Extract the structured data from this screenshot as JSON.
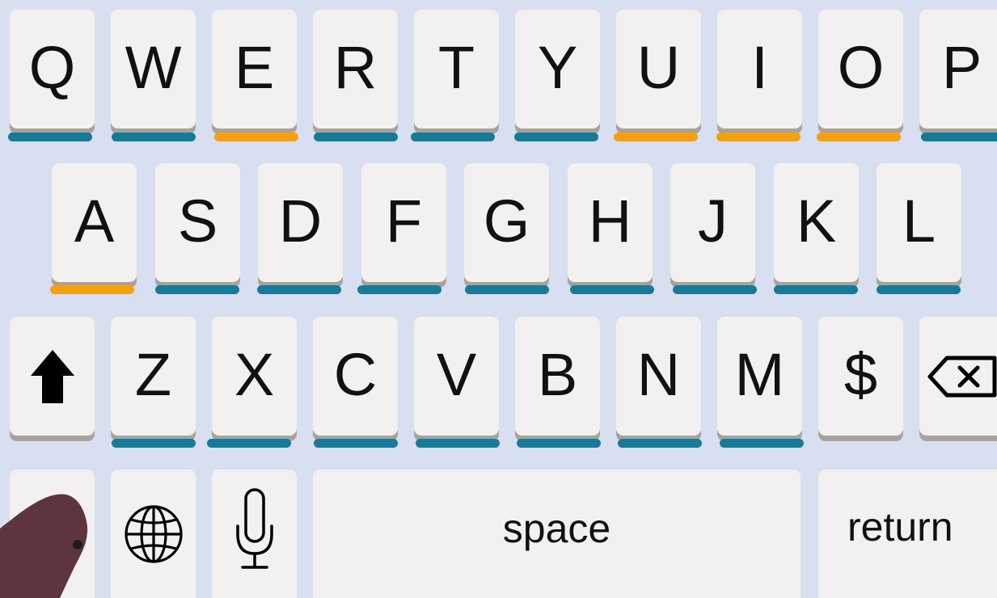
{
  "keyboard": {
    "row1": [
      {
        "label": "Q",
        "underline": "blue"
      },
      {
        "label": "W",
        "underline": "blue"
      },
      {
        "label": "E",
        "underline": "orange"
      },
      {
        "label": "R",
        "underline": "blue"
      },
      {
        "label": "T",
        "underline": "blue"
      },
      {
        "label": "Y",
        "underline": "blue"
      },
      {
        "label": "U",
        "underline": "orange"
      },
      {
        "label": "I",
        "underline": "orange"
      },
      {
        "label": "O",
        "underline": "orange"
      },
      {
        "label": "P",
        "underline": "blue"
      }
    ],
    "row2": [
      {
        "label": "A",
        "underline": "orange"
      },
      {
        "label": "S",
        "underline": "blue"
      },
      {
        "label": "D",
        "underline": "blue"
      },
      {
        "label": "F",
        "underline": "blue"
      },
      {
        "label": "G",
        "underline": "blue"
      },
      {
        "label": "H",
        "underline": "blue"
      },
      {
        "label": "J",
        "underline": "blue"
      },
      {
        "label": "K",
        "underline": "blue"
      },
      {
        "label": "L",
        "underline": "blue"
      }
    ],
    "row3": [
      {
        "label": "Z",
        "underline": "blue"
      },
      {
        "label": "X",
        "underline": "blue"
      },
      {
        "label": "C",
        "underline": "blue"
      },
      {
        "label": "V",
        "underline": "blue"
      },
      {
        "label": "B",
        "underline": "blue"
      },
      {
        "label": "N",
        "underline": "blue"
      },
      {
        "label": "M",
        "underline": "blue"
      },
      {
        "label": "$",
        "underline": null
      }
    ],
    "shift_icon": "shift-arrow-icon",
    "backspace_icon": "backspace-icon",
    "globe_icon": "globe-icon",
    "mic_icon": "microphone-icon",
    "space_label": "space",
    "return_label": "return"
  },
  "colors": {
    "background": "#d7dff0",
    "key": "#f2f1ef",
    "key_shadow": "#aaa29a",
    "underline_blue": "#167b99",
    "underline_orange": "#f5a10d",
    "hand": "#5e353e"
  }
}
